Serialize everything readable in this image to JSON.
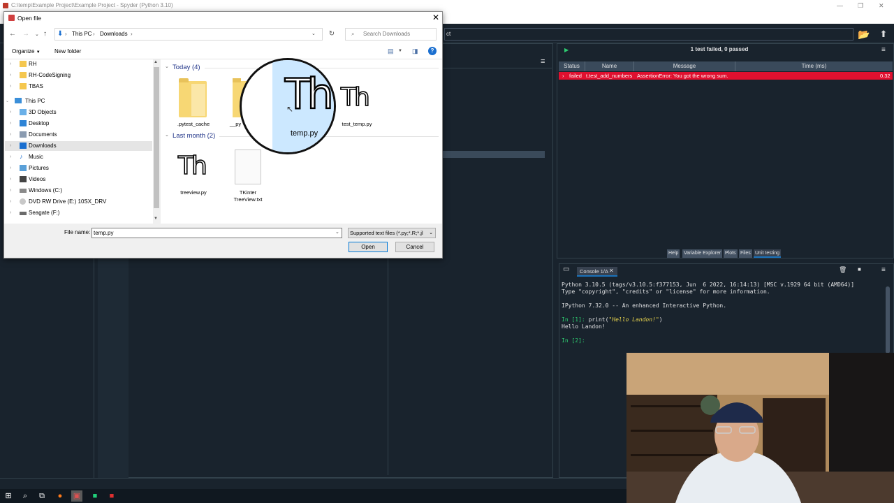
{
  "spyder": {
    "title": "C:\\temp\\Example Project\\Example Project - Spyder (Python 3.10)",
    "path_combo": "ct",
    "unit_testing": {
      "summary": "1 test failed, 0 passed",
      "columns": [
        "Status",
        "Name",
        "Message",
        "Time (ms)"
      ],
      "row": {
        "status": "failed",
        "name": "t.test_add_numbers",
        "message": "AssertionError: You got the wrong sum.",
        "time": "0.32"
      }
    },
    "pane_tabs": [
      "Help",
      "Variable Explorer",
      "Plots",
      "Files",
      "Unit testing"
    ],
    "console": {
      "tab_label": "Console 1/A",
      "line1": "Python 3.10.5 (tags/v3.10.5:f377153, Jun  6 2022, 16:14:13) [MSC v.1929 64 bit (AMD64)]",
      "line2": "Type \"copyright\", \"credits\" or \"license\" for more information.",
      "line3": "IPython 7.32.0 -- An enhanced Interactive Python.",
      "prompt1": "In [1]: ",
      "code1_a": "print(",
      "code1_str": "\"Hello Landon!\"",
      "code1_b": ")",
      "output1": "Hello Landon!",
      "prompt2": "In [2]:"
    }
  },
  "dialog": {
    "title": "Open file",
    "breadcrumb": [
      "This PC",
      "Downloads"
    ],
    "search_placeholder": "Search Downloads",
    "organize": "Organize",
    "new_folder": "New folder",
    "nav_items": [
      {
        "label": "RH",
        "icon": "folder-icon"
      },
      {
        "label": "RH-CodeSigning",
        "icon": "folder-icon"
      },
      {
        "label": "TBAS",
        "icon": "folder-icon"
      },
      {
        "label": "This PC",
        "icon": "computer-icon"
      },
      {
        "label": "3D Objects",
        "icon": "3d-objects-icon"
      },
      {
        "label": "Desktop",
        "icon": "desktop-icon"
      },
      {
        "label": "Documents",
        "icon": "documents-icon"
      },
      {
        "label": "Downloads",
        "icon": "downloads-icon"
      },
      {
        "label": "Music",
        "icon": "music-icon"
      },
      {
        "label": "Pictures",
        "icon": "pictures-icon"
      },
      {
        "label": "Videos",
        "icon": "videos-icon"
      },
      {
        "label": "Windows (C:)",
        "icon": "drive-icon"
      },
      {
        "label": "DVD RW Drive (E:) 10SX_DRV",
        "icon": "dvd-icon"
      },
      {
        "label": "Seagate (F:)",
        "icon": "drive-icon"
      }
    ],
    "groups": [
      {
        "label": "Today (4)"
      },
      {
        "label": "Last month (2)"
      }
    ],
    "files": [
      {
        "label": ".pytest_cache"
      },
      {
        "label": "__py"
      },
      {
        "label": "temp.py"
      },
      {
        "label": "test_temp.py"
      },
      {
        "label": "treeview.py"
      },
      {
        "label": "TKinter TreeView.txt"
      }
    ],
    "file_name_label": "File name:",
    "file_name_value": "temp.py",
    "filter": "Supported text files (*.py;*.R;*.jl",
    "open_label": "Open",
    "cancel_label": "Cancel",
    "icon_glyph": "Th"
  }
}
